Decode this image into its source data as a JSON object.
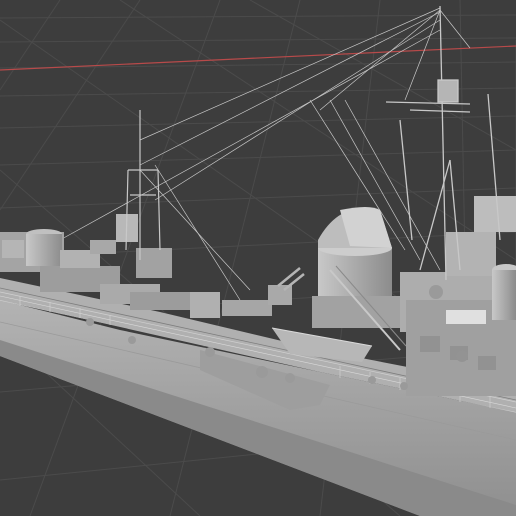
{
  "viewport": {
    "kind": "3d-viewport",
    "background": "#3d3d3d",
    "grid_color": "#4a4a4a",
    "x_axis_color": "#b84a4a",
    "model_color": "#a9a9a9",
    "model_shadow": "#8a8a8a",
    "model_highlight": "#c4c4c4",
    "object": "destroyer-warship-model",
    "shading": "solid"
  }
}
